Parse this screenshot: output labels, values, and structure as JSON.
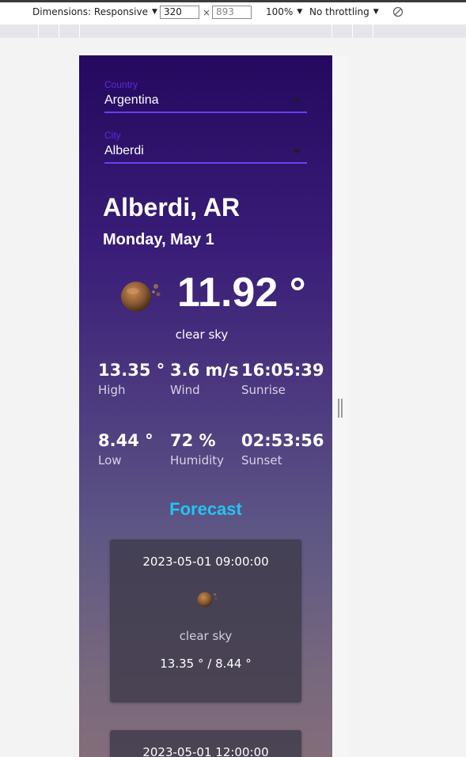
{
  "devtools": {
    "dimensions_label": "Dimensions: Responsive",
    "width_value": "320",
    "height_placeholder": "893",
    "times": "×",
    "zoom_label": "100%",
    "throttle_label": "No throttling"
  },
  "form": {
    "country": {
      "label": "Country",
      "value": "Argentina"
    },
    "city": {
      "label": "City",
      "value": "Alberdi"
    }
  },
  "weather": {
    "location": "Alberdi, AR",
    "date": "Monday, May 1",
    "icon": "moon-icon",
    "temperature": "11.92 °",
    "description": "clear sky",
    "stats": [
      {
        "value": "13.35 °",
        "label": "High"
      },
      {
        "value": "3.6 m/s",
        "label": "Wind"
      },
      {
        "value": "16:05:39",
        "label": "Sunrise"
      },
      {
        "value": "8.44 °",
        "label": "Low"
      },
      {
        "value": "72 %",
        "label": "Humidity"
      },
      {
        "value": "02:53:56",
        "label": "Sunset"
      }
    ]
  },
  "forecast": {
    "title": "Forecast",
    "items": [
      {
        "time": "2023-05-01 09:00:00",
        "icon": "moon-icon",
        "description": "clear sky",
        "temps": "13.35 ° / 8.44 °"
      },
      {
        "time": "2023-05-01 12:00:00"
      }
    ]
  },
  "colors": {
    "accent": "#22c4f2",
    "underline": "#6a3ef0"
  }
}
